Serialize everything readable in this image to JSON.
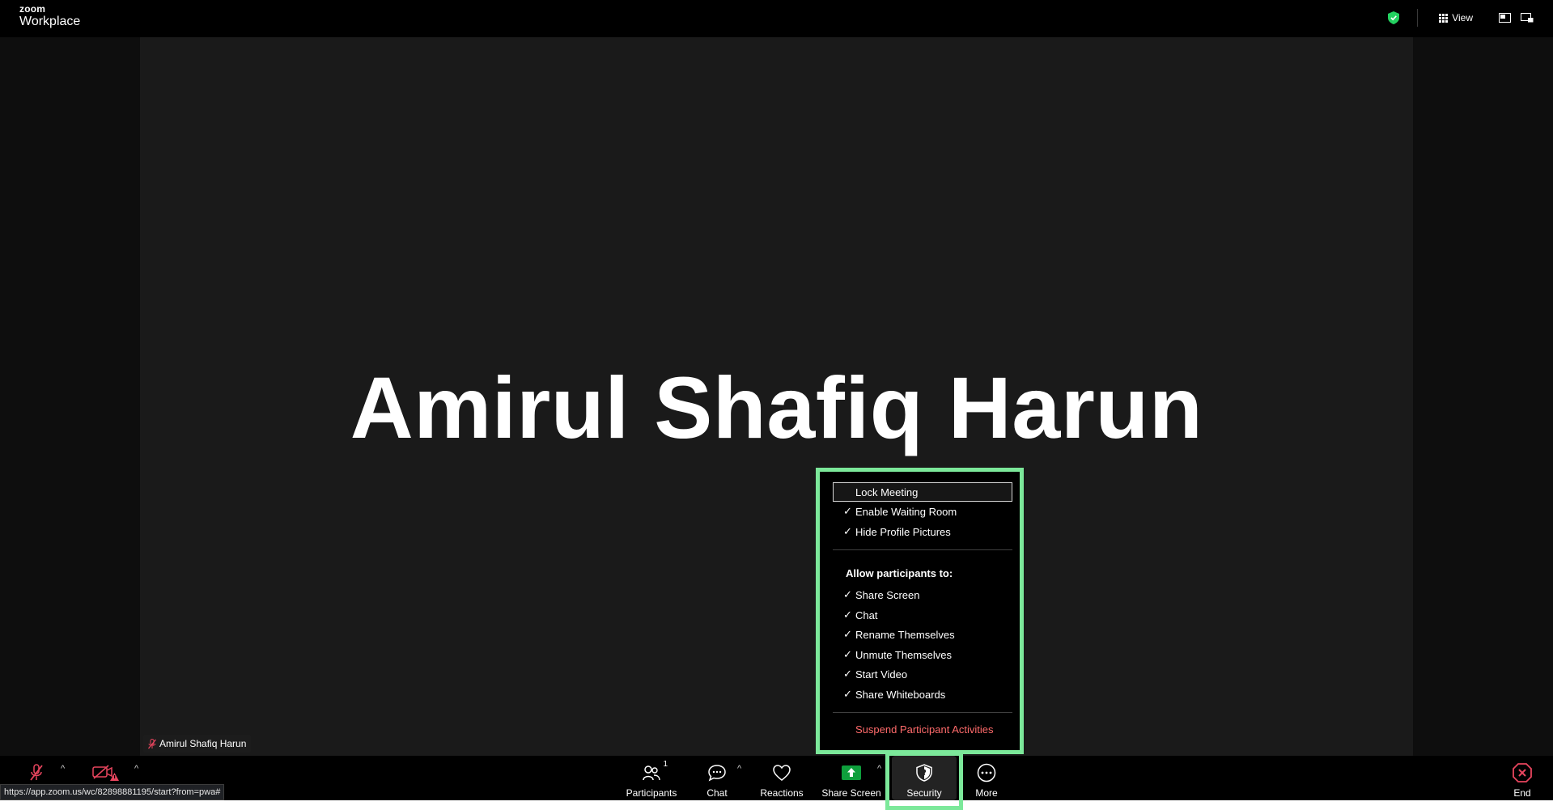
{
  "header": {
    "logo_line1": "zoom",
    "logo_line2": "Workplace",
    "view_label": "View",
    "shield_color": "#23d160"
  },
  "stage": {
    "participant_display_name": "Amirul Shafiq Harun",
    "name_tag": "Amirul Shafiq Harun",
    "background_color": "#1a1a1a"
  },
  "security_menu": {
    "items_top": [
      {
        "label": "Lock Meeting",
        "checked": false
      },
      {
        "label": "Enable Waiting Room",
        "checked": true
      },
      {
        "label": "Hide Profile Pictures",
        "checked": true
      }
    ],
    "allow_heading": "Allow participants to:",
    "allow_items": [
      {
        "label": "Share Screen",
        "checked": true
      },
      {
        "label": "Chat",
        "checked": true
      },
      {
        "label": "Rename Themselves",
        "checked": true
      },
      {
        "label": "Unmute Themselves",
        "checked": true
      },
      {
        "label": "Start Video",
        "checked": true
      },
      {
        "label": "Share Whiteboards",
        "checked": true
      }
    ],
    "suspend_label": "Suspend Participant Activities",
    "check_glyph": "✓"
  },
  "toolbar": {
    "participants_label": "Participants",
    "participants_count": "1",
    "chat_label": "Chat",
    "reactions_label": "Reactions",
    "share_label": "Share Screen",
    "security_label": "Security",
    "more_label": "More",
    "end_label": "End",
    "caret": "^",
    "share_color": "#0e9f3c",
    "mute_color": "#e8455e",
    "end_color": "#e8455e"
  },
  "status_url": "https://app.zoom.us/wc/82898881195/start?from=pwa#",
  "highlight_color": "#7ce89a"
}
